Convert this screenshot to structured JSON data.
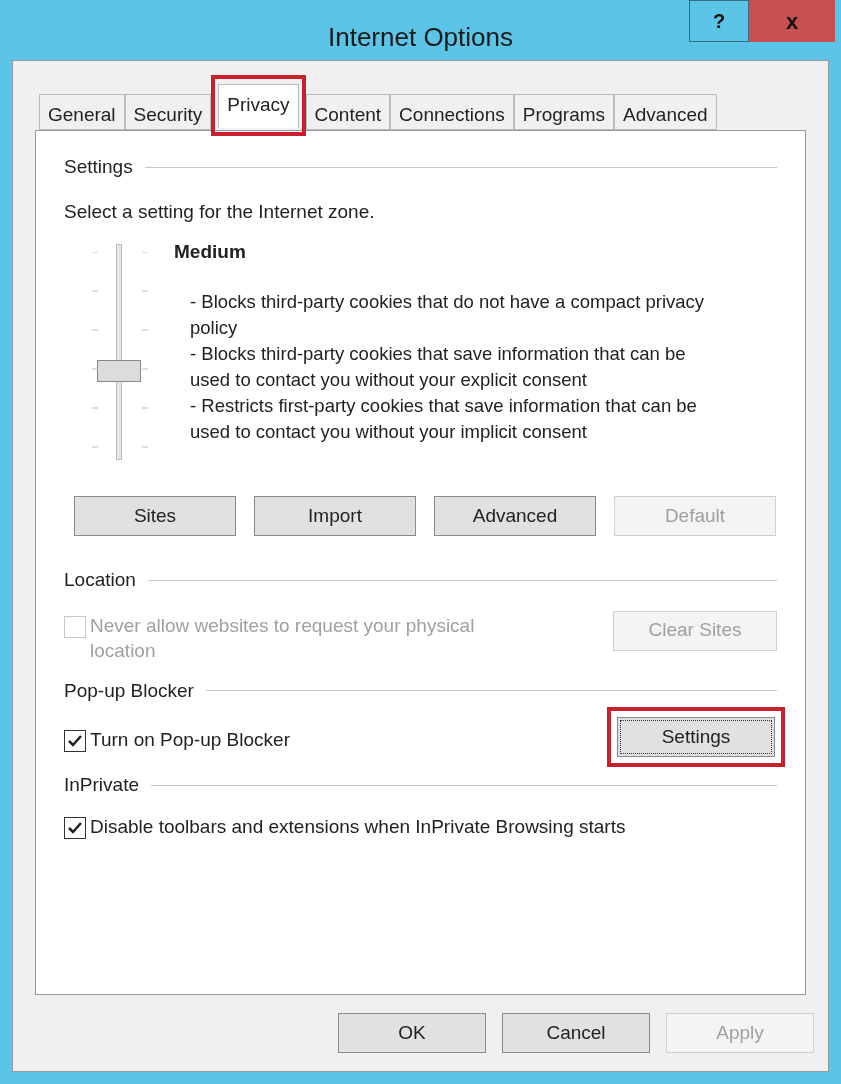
{
  "window": {
    "title": "Internet Options",
    "help": "?",
    "close": "x"
  },
  "tabs": [
    {
      "label": "General",
      "selected": false,
      "highlighted": false
    },
    {
      "label": "Security",
      "selected": false,
      "highlighted": false
    },
    {
      "label": "Privacy",
      "selected": true,
      "highlighted": true
    },
    {
      "label": "Content",
      "selected": false,
      "highlighted": false
    },
    {
      "label": "Connections",
      "selected": false,
      "highlighted": false
    },
    {
      "label": "Programs",
      "selected": false,
      "highlighted": false
    },
    {
      "label": "Advanced",
      "selected": false,
      "highlighted": false
    }
  ],
  "settings": {
    "heading": "Settings",
    "prompt": "Select a setting for the Internet zone.",
    "slider": {
      "level": 0.4
    },
    "level_name": "Medium",
    "description": [
      "- Blocks third-party cookies that do not have a compact privacy policy",
      "- Blocks third-party cookies that save information that can be used to contact you without your explicit consent",
      "- Restricts first-party cookies that save information that can be used to contact you without your implicit consent"
    ],
    "buttons": [
      {
        "label": "Sites",
        "disabled": false
      },
      {
        "label": "Import",
        "disabled": false
      },
      {
        "label": "Advanced",
        "disabled": false
      },
      {
        "label": "Default",
        "disabled": true
      }
    ]
  },
  "location": {
    "heading": "Location",
    "checkbox": {
      "label": "Never allow websites to request your physical location",
      "checked": false,
      "disabled": true
    },
    "button": {
      "label": "Clear Sites",
      "disabled": true,
      "focused": false,
      "highlighted": false
    }
  },
  "popup_blocker": {
    "heading": "Pop-up Blocker",
    "checkbox": {
      "label": "Turn on Pop-up Blocker",
      "checked": true,
      "disabled": false
    },
    "button": {
      "label": "Settings",
      "disabled": false,
      "focused": true,
      "highlighted": true
    }
  },
  "inprivate": {
    "heading": "InPrivate",
    "checkbox": {
      "label": "Disable toolbars and extensions when InPrivate Browsing starts",
      "checked": true,
      "disabled": false
    }
  },
  "footer_buttons": [
    {
      "label": "OK",
      "disabled": false
    },
    {
      "label": "Cancel",
      "disabled": false
    },
    {
      "label": "Apply",
      "disabled": true
    }
  ]
}
